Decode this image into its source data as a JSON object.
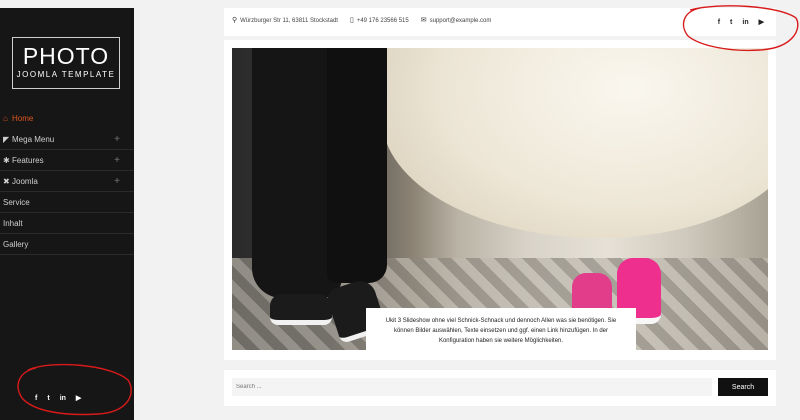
{
  "logo": {
    "title": "PHOTO",
    "subtitle": "JOOMLA TEMPLATE"
  },
  "menu": {
    "items": [
      {
        "label": "Home",
        "icon": "home-icon",
        "active": true,
        "has_children": false
      },
      {
        "label": "Mega Menu",
        "icon": "megaphone-icon",
        "active": false,
        "has_children": true
      },
      {
        "label": "Features",
        "icon": "gear-icon",
        "active": false,
        "has_children": true
      },
      {
        "label": "Joomla",
        "icon": "joomla-icon",
        "active": false,
        "has_children": true
      },
      {
        "label": "Service",
        "icon": "",
        "active": false,
        "has_children": false
      },
      {
        "label": "Inhalt",
        "icon": "",
        "active": false,
        "has_children": false
      },
      {
        "label": "Gallery",
        "icon": "",
        "active": false,
        "has_children": false
      }
    ]
  },
  "contact": {
    "address": "Würzburger Str 11, 63811 Stockstadt",
    "phone": "+49 176 23566 515",
    "email": "support@example.com"
  },
  "social": [
    "f",
    "t",
    "in",
    "▶"
  ],
  "hero": {
    "caption": "Ukit 3 Slideshow ohne viel Schnick-Schnack und dennoch Allen was sie benötigen. Sie können Bilder auswählen, Texte einsetzen und ggf. einen Link hinzufügen. In der Konfiguration haben sie weitere Möglichkeiten."
  },
  "search": {
    "placeholder": "Search ...",
    "button": "Search"
  },
  "colors": {
    "active": "#e0551e",
    "sidebar": "#161616",
    "annotation": "#d81a1a"
  }
}
